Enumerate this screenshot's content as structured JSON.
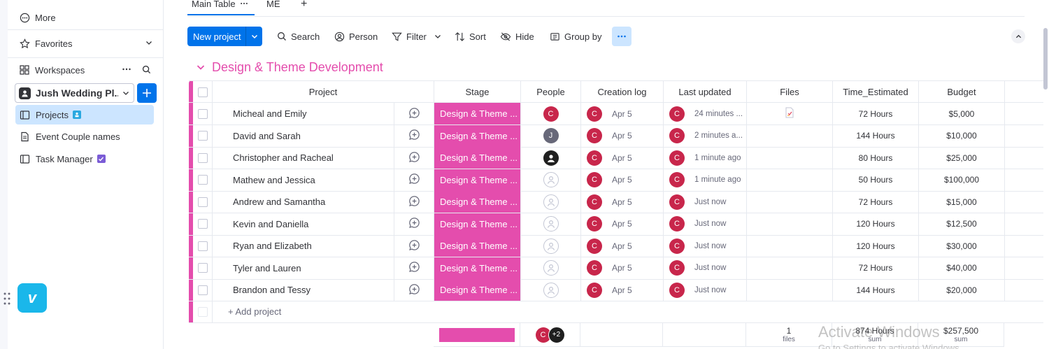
{
  "sidebar": {
    "more_label": "More",
    "favorites_label": "Favorites",
    "workspaces_label": "Workspaces",
    "workspace_name": "Jush Wedding Pl...",
    "boards": [
      {
        "label": "Projects",
        "active": true
      },
      {
        "label": "Event Couple names",
        "active": false
      },
      {
        "label": "Task Manager",
        "active": false
      }
    ]
  },
  "tabs": {
    "main": "Main Table",
    "second": "ME",
    "add": "+"
  },
  "toolbar": {
    "new_project": "New project",
    "search": "Search",
    "person": "Person",
    "filter": "Filter",
    "sort": "Sort",
    "hide": "Hide",
    "group_by": "Group by"
  },
  "group": {
    "title": "Design & Theme Development",
    "color": "#e44dad"
  },
  "columns": [
    "Project",
    "Stage",
    "People",
    "Creation log",
    "Last updated",
    "Files",
    "Time_Estimated",
    "Budget"
  ],
  "rows": [
    {
      "project": "Micheal and Emily",
      "stage": "Design & Theme ...",
      "people": "C",
      "created": "Apr 5",
      "updated": "24 minutes ...",
      "file": true,
      "time": "72 Hours",
      "budget": "$5,000"
    },
    {
      "project": "David and Sarah",
      "stage": "Design & Theme ...",
      "people": "J",
      "created": "Apr 5",
      "updated": "2 minutes a...",
      "file": false,
      "time": "144 Hours",
      "budget": "$10,000"
    },
    {
      "project": "Christopher and Racheal",
      "stage": "Design & Theme ...",
      "people": "dark",
      "created": "Apr 5",
      "updated": "1 minute ago",
      "file": false,
      "time": "80 Hours",
      "budget": "$25,000"
    },
    {
      "project": "Mathew and Jessica",
      "stage": "Design & Theme ...",
      "people": "",
      "created": "Apr 5",
      "updated": "1 minute ago",
      "file": false,
      "time": "50 Hours",
      "budget": "$100,000"
    },
    {
      "project": "Andrew and Samantha",
      "stage": "Design & Theme ...",
      "people": "",
      "created": "Apr 5",
      "updated": "Just now",
      "file": false,
      "time": "72 Hours",
      "budget": "$15,000"
    },
    {
      "project": "Kevin and Daniella",
      "stage": "Design & Theme ...",
      "people": "",
      "created": "Apr 5",
      "updated": "Just now",
      "file": false,
      "time": "120 Hours",
      "budget": "$12,500"
    },
    {
      "project": "Ryan and Elizabeth",
      "stage": "Design & Theme ...",
      "people": "",
      "created": "Apr 5",
      "updated": "Just now",
      "file": false,
      "time": "120 Hours",
      "budget": "$30,000"
    },
    {
      "project": "Tyler and Lauren",
      "stage": "Design & Theme ...",
      "people": "",
      "created": "Apr 5",
      "updated": "Just now",
      "file": false,
      "time": "72 Hours",
      "budget": "$40,000"
    },
    {
      "project": "Brandon and Tessy",
      "stage": "Design & Theme ...",
      "people": "",
      "created": "Apr 5",
      "updated": "Just now",
      "file": false,
      "time": "144 Hours",
      "budget": "$20,000"
    }
  ],
  "add_row_label": "+ Add project",
  "log_badge": "C",
  "summary": {
    "people_more": "+2",
    "people_first": "C",
    "files_count": "1",
    "files_label": "files",
    "time_total": "874 Hours",
    "time_label": "sum",
    "budget_total": "$257,500",
    "budget_label": "sum"
  },
  "watermark": {
    "line1": "Activate Windows",
    "line2": "Go to Settings to activate Windows."
  }
}
